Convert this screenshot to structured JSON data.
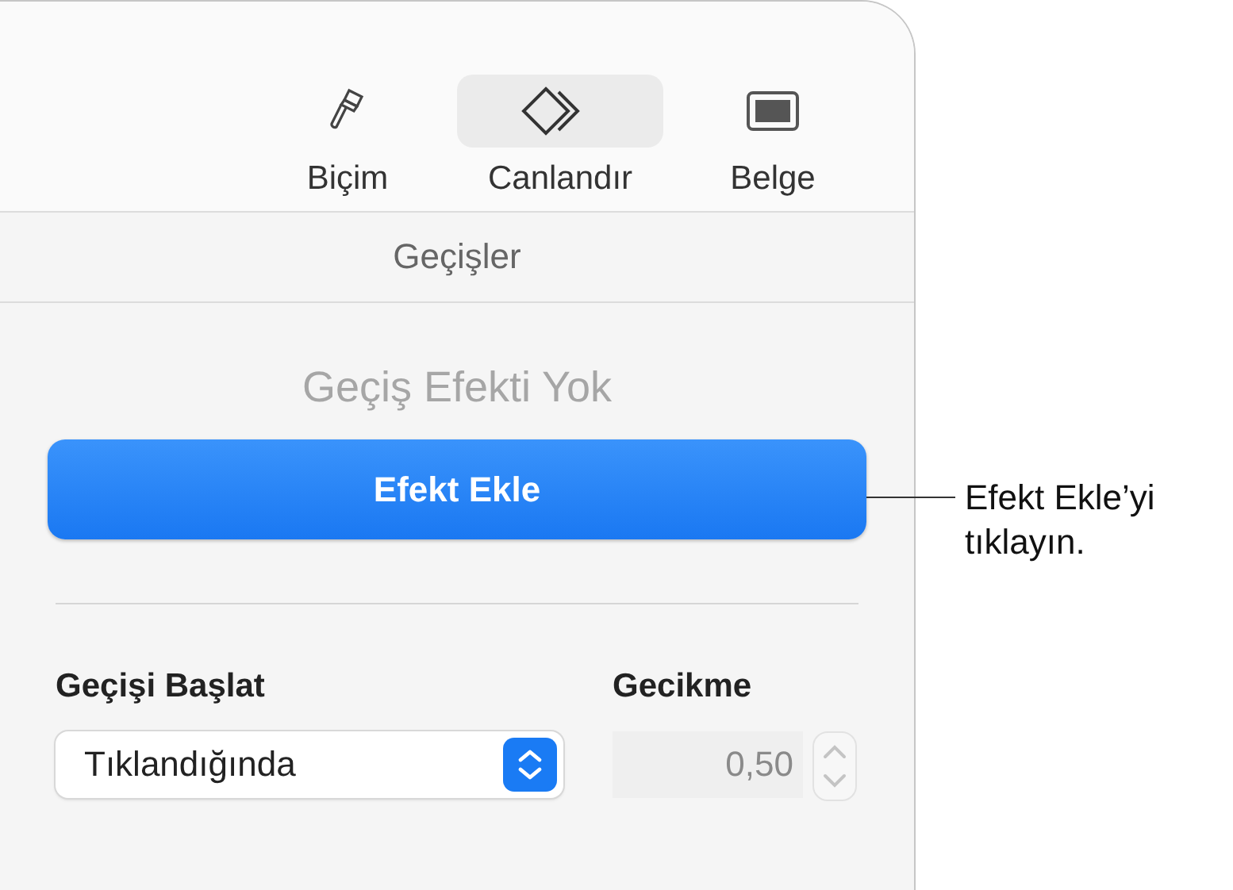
{
  "toolbar": [
    {
      "kind": "format",
      "label": "Biçim",
      "selected": false
    },
    {
      "kind": "animate",
      "label": "Canlandır",
      "selected": true
    },
    {
      "kind": "document",
      "label": "Belge",
      "selected": false
    }
  ],
  "section_tab": "Geçişler",
  "transition": {
    "status": "Geçiş Efekti Yok",
    "button": "Efekt Ekle"
  },
  "start": {
    "label": "Geçişi Başlat",
    "value": "Tıklandığında"
  },
  "delay": {
    "label": "Gecikme",
    "value": "0,50",
    "disabled": true
  },
  "callout": {
    "text": "Efekt Ekle’yi tıklayın."
  }
}
